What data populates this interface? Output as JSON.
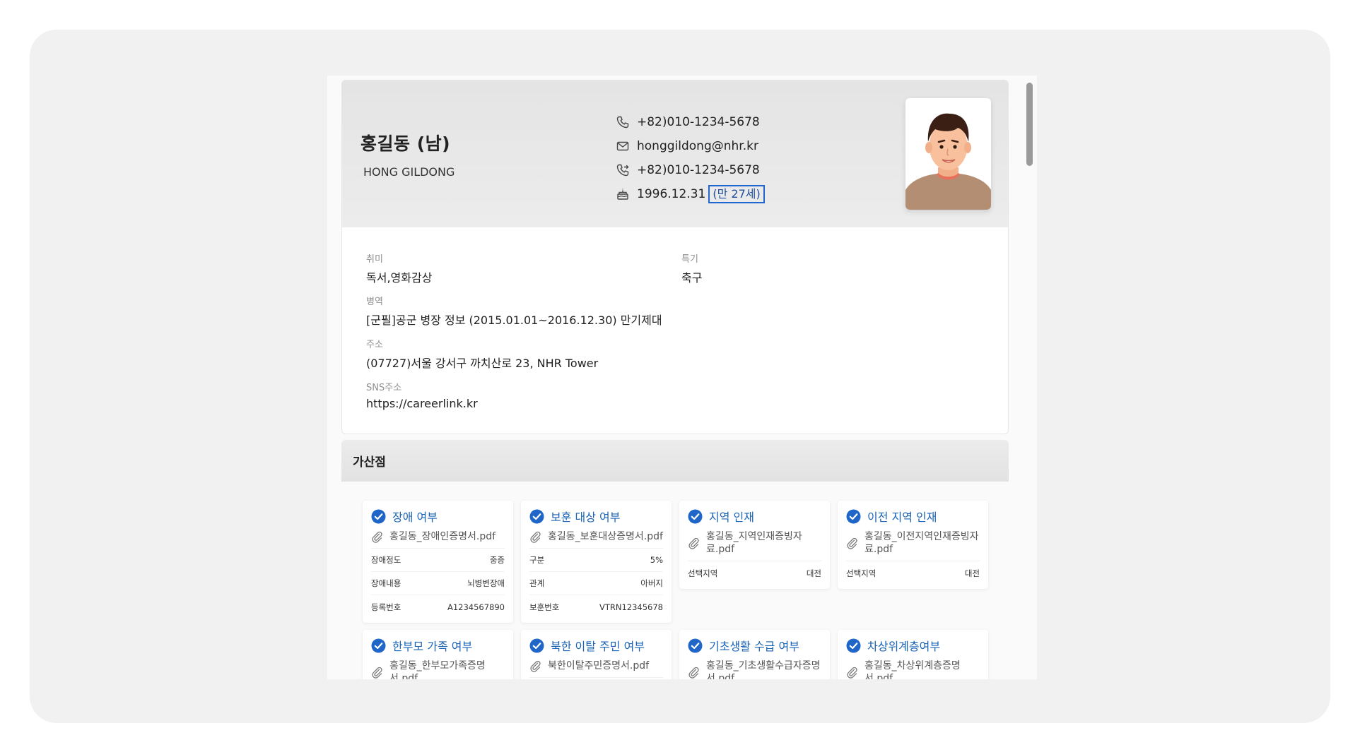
{
  "profile": {
    "name_ko": "홍길동 (남)",
    "name_en": "HONG GILDONG",
    "phone": "+82)010-1234-5678",
    "email": "honggildong@nhr.kr",
    "emergency_phone": "+82)010-1234-5678",
    "birth_date": "1996.12.31",
    "age": "(만 27세)"
  },
  "details": {
    "hobby": {
      "label": "취미",
      "value": "독서,영화감상"
    },
    "specialty": {
      "label": "특기",
      "value": "축구"
    },
    "military": {
      "label": "병역",
      "value": "[군필]공군 병장 정보 (2015.01.01~2016.12.30) 만기제대"
    },
    "address": {
      "label": "주소",
      "value": "(07727)서울 강서구 까치산로 23, NHR Tower"
    },
    "sns": {
      "label": "SNS주소",
      "value": "https://careerlink.kr"
    }
  },
  "bonus": {
    "title": "가산점",
    "cards": [
      {
        "title": "장애 여부",
        "file": "홍길동_장애인증명서.pdf",
        "rows": [
          {
            "k": "장애정도",
            "v": "중증"
          },
          {
            "k": "장애내용",
            "v": "뇌병변장애"
          },
          {
            "k": "등록번호",
            "v": "A1234567890"
          }
        ]
      },
      {
        "title": "보훈 대상 여부",
        "file": "홍길동_보훈대상증명서.pdf",
        "rows": [
          {
            "k": "구분",
            "v": "5%"
          },
          {
            "k": "관계",
            "v": "아버지"
          },
          {
            "k": "보훈번호",
            "v": "VTRN12345678"
          }
        ]
      },
      {
        "title": "지역 인재",
        "file": "홍길동_지역인재증빙자료.pdf",
        "rows": [
          {
            "k": "선택지역",
            "v": "대전"
          }
        ]
      },
      {
        "title": "이전 지역 인재",
        "file": "홍길동_이전지역인재증빙자료.pdf",
        "rows": [
          {
            "k": "선택지역",
            "v": "대전"
          }
        ]
      },
      {
        "title": "한부모 가족 여부",
        "file": "홍길동_한부모가족증명서.pdf",
        "rows": []
      },
      {
        "title": "북한 이탈 주민 여부",
        "file": "북한이탈주민증명서.pdf",
        "rows": []
      },
      {
        "title": "기초생활 수급 여부",
        "file": "홍길동_기초생활수급자증명서.pdf",
        "rows": []
      },
      {
        "title": "차상위계층여부",
        "file": "홍길동_차상위계층증명서.pdf",
        "rows": []
      }
    ]
  },
  "colors": {
    "accent": "#1a63b5",
    "highlight_border": "#1f66d1",
    "check": "#1f66c8"
  }
}
